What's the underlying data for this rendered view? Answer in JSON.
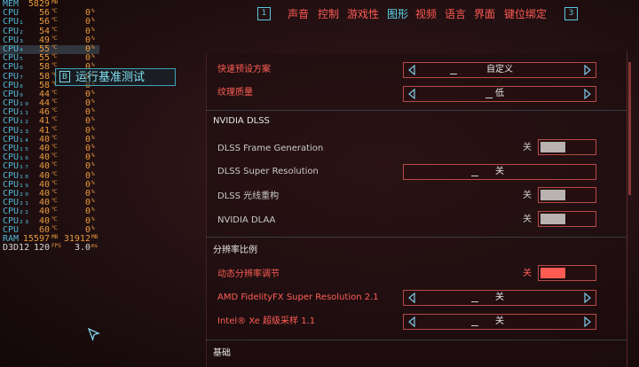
{
  "osd": {
    "rows": [
      {
        "label": "MEM",
        "v1": "5829",
        "u1": "MB",
        "v2": "",
        "u2": "",
        "hl": false
      },
      {
        "label": "CPU",
        "v1": "56",
        "u1": "℃",
        "v2": "0",
        "u2": "%",
        "hl": false
      },
      {
        "label": "CPU₁",
        "v1": "56",
        "u1": "℃",
        "v2": "0",
        "u2": "%",
        "hl": false
      },
      {
        "label": "CPU₂",
        "v1": "54",
        "u1": "℃",
        "v2": "0",
        "u2": "%",
        "hl": false
      },
      {
        "label": "CPU₃",
        "v1": "49",
        "u1": "℃",
        "v2": "0",
        "u2": "%",
        "hl": false
      },
      {
        "label": "CPU₄",
        "v1": "55",
        "u1": "℃",
        "v2": "0",
        "u2": "%",
        "hl": true
      },
      {
        "label": "CPU₅",
        "v1": "55",
        "u1": "℃",
        "v2": "0",
        "u2": "%",
        "hl": false
      },
      {
        "label": "CPU₆",
        "v1": "58",
        "u1": "℃",
        "v2": "0",
        "u2": "%",
        "hl": false
      },
      {
        "label": "CPU₇",
        "v1": "58",
        "u1": "℃",
        "v2": "0",
        "u2": "%",
        "hl": false
      },
      {
        "label": "CPU₈",
        "v1": "58",
        "u1": "℃",
        "v2": "0",
        "u2": "%",
        "hl": false
      },
      {
        "label": "CPU₉",
        "v1": "44",
        "u1": "℃",
        "v2": "0",
        "u2": "%",
        "hl": false
      },
      {
        "label": "CPU₁₀",
        "v1": "44",
        "u1": "℃",
        "v2": "0",
        "u2": "%",
        "hl": false
      },
      {
        "label": "CPU₁₁",
        "v1": "46",
        "u1": "℃",
        "v2": "0",
        "u2": "%",
        "hl": false
      },
      {
        "label": "CPU₁₂",
        "v1": "41",
        "u1": "℃",
        "v2": "0",
        "u2": "%",
        "hl": false
      },
      {
        "label": "CPU₁₃",
        "v1": "41",
        "u1": "℃",
        "v2": "0",
        "u2": "%",
        "hl": false
      },
      {
        "label": "CPU₁₄",
        "v1": "40",
        "u1": "℃",
        "v2": "0",
        "u2": "%",
        "hl": false
      },
      {
        "label": "CPU₁₅",
        "v1": "40",
        "u1": "℃",
        "v2": "0",
        "u2": "%",
        "hl": false
      },
      {
        "label": "CPU₁₆",
        "v1": "40",
        "u1": "℃",
        "v2": "0",
        "u2": "%",
        "hl": false
      },
      {
        "label": "CPU₁₇",
        "v1": "40",
        "u1": "℃",
        "v2": "0",
        "u2": "%",
        "hl": false
      },
      {
        "label": "CPU₁₈",
        "v1": "40",
        "u1": "℃",
        "v2": "0",
        "u2": "%",
        "hl": false
      },
      {
        "label": "CPU₁₉",
        "v1": "40",
        "u1": "℃",
        "v2": "0",
        "u2": "%",
        "hl": false
      },
      {
        "label": "CPU₂₀",
        "v1": "40",
        "u1": "℃",
        "v2": "0",
        "u2": "%",
        "hl": false
      },
      {
        "label": "CPU₂₁",
        "v1": "40",
        "u1": "℃",
        "v2": "0",
        "u2": "%",
        "hl": false
      },
      {
        "label": "CPU₂₂",
        "v1": "40",
        "u1": "℃",
        "v2": "0",
        "u2": "%",
        "hl": false
      },
      {
        "label": "CPU₂₃",
        "v1": "40",
        "u1": "℃",
        "v2": "0",
        "u2": "%",
        "hl": false
      },
      {
        "label": "CPU",
        "v1": "60",
        "u1": "℃",
        "v2": "0",
        "u2": "%",
        "hl": false
      },
      {
        "label": "RAM",
        "v1": "15597",
        "u1": "MB",
        "v2": "31912",
        "u2": "MB",
        "hl": false
      },
      {
        "label": "D3D12",
        "v1": "120",
        "u1": "FPS",
        "v2": "3.0",
        "u2": "ms",
        "hl": false,
        "wide": true
      }
    ]
  },
  "benchmark": {
    "key": "B",
    "label": "运行基准测试"
  },
  "nav": {
    "key_left": "1",
    "key_right": "3",
    "tabs": [
      "声音",
      "控制",
      "游戏性",
      "图形",
      "视频",
      "语言",
      "界面",
      "键位绑定"
    ],
    "active_index": 3
  },
  "settings": {
    "quick_preset": {
      "label": "快速预设方案",
      "value": "自定义"
    },
    "texture_quality": {
      "label": "纹理质量",
      "value": "低"
    },
    "dlss_section": "NVIDIA DLSS",
    "frame_gen": {
      "label": "DLSS Frame Generation",
      "value": "关"
    },
    "super_res": {
      "label": "DLSS Super Resolution",
      "value": "关"
    },
    "ray_recon": {
      "label": "DLSS 光线重构",
      "value": "关"
    },
    "dlaa": {
      "label": "NVIDIA DLAA",
      "value": "关"
    },
    "res_section": "分辨率比例",
    "dyn_res": {
      "label": "动态分辨率调节",
      "value": "关"
    },
    "fsr": {
      "label": "AMD FidelityFX Super Resolution 2.1",
      "value": "关"
    },
    "xess": {
      "label": "Intel® Xe 超级采样 1.1",
      "value": "关"
    },
    "basic_section": "基础"
  },
  "colors": {
    "accent_red": "#ff5a54",
    "accent_cyan": "#5bd8ee"
  }
}
